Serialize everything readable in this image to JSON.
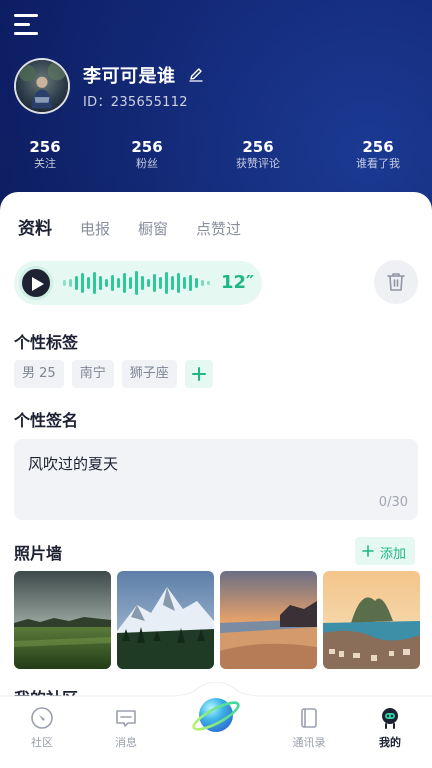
{
  "profile": {
    "name": "李可可是谁",
    "id_text": "ID：235655112"
  },
  "stats": [
    {
      "value": "256",
      "label": "关注"
    },
    {
      "value": "256",
      "label": "粉丝"
    },
    {
      "value": "256",
      "label": "获赞评论"
    },
    {
      "value": "256",
      "label": "谁看了我"
    }
  ],
  "tabs": [
    {
      "label": "资料",
      "active": true
    },
    {
      "label": "电报",
      "active": false
    },
    {
      "label": "橱窗",
      "active": false
    },
    {
      "label": "点赞过",
      "active": false
    }
  ],
  "voice": {
    "duration": "12″"
  },
  "tags_section": {
    "title": "个性标签",
    "tags": [
      "男 25",
      "南宁",
      "狮子座"
    ]
  },
  "signature_section": {
    "title": "个性签名",
    "text": "风吹过的夏天",
    "counter": "0/30"
  },
  "photos_section": {
    "title": "照片墙",
    "add_label": "添加",
    "photos": [
      "grassland-photo",
      "snow-mountain-photo",
      "beach-sunset-photo",
      "coastal-city-photo"
    ]
  },
  "community_section": {
    "title": "我的社区"
  },
  "bottom_nav": [
    {
      "label": "社区",
      "icon": "compass-icon",
      "active": false
    },
    {
      "label": "消息",
      "icon": "message-icon",
      "active": false
    },
    {
      "label": "",
      "icon": "planet-icon",
      "active": false
    },
    {
      "label": "通讯录",
      "icon": "contacts-icon",
      "active": false
    },
    {
      "label": "我的",
      "icon": "profile-icon",
      "active": true
    }
  ],
  "colors": {
    "header_bg": "#0b1a57",
    "accent": "#1fb786",
    "accent_light": "#e5f8f1",
    "text_dark": "#1d2233"
  }
}
